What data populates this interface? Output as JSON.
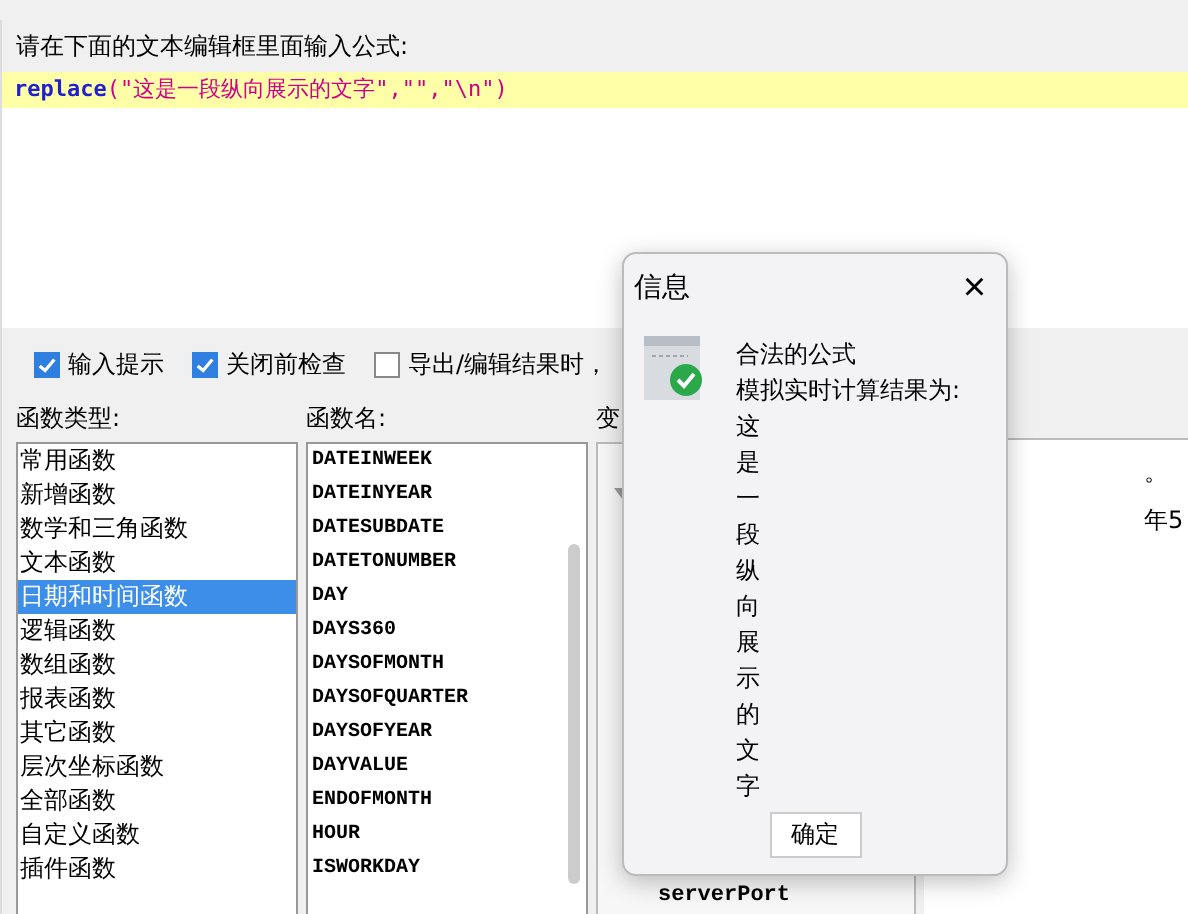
{
  "editor": {
    "label": "请在下面的文本编辑框里面输入公式:",
    "tokens": [
      {
        "kind": "fn",
        "text": "replace"
      },
      {
        "kind": "paren",
        "text": "("
      },
      {
        "kind": "string",
        "text": "\"这是一段纵向展示的文字\",\"\",\"\\n\""
      },
      {
        "kind": "paren",
        "text": ")"
      }
    ]
  },
  "options": [
    {
      "label": "输入提示",
      "checked": true
    },
    {
      "label": "关闭前检查",
      "checked": true
    },
    {
      "label": "导出/编辑结果时，",
      "checked": false
    }
  ],
  "categories": {
    "title": "函数类型:",
    "items": [
      {
        "label": "常用函数",
        "selected": false
      },
      {
        "label": "新增函数",
        "selected": false
      },
      {
        "label": "数学和三角函数",
        "selected": false
      },
      {
        "label": "文本函数",
        "selected": false
      },
      {
        "label": "日期和时间函数",
        "selected": true
      },
      {
        "label": "逻辑函数",
        "selected": false
      },
      {
        "label": "数组函数",
        "selected": false
      },
      {
        "label": "报表函数",
        "selected": false
      },
      {
        "label": "其它函数",
        "selected": false
      },
      {
        "label": "层次坐标函数",
        "selected": false
      },
      {
        "label": "全部函数",
        "selected": false
      },
      {
        "label": "自定义函数",
        "selected": false
      },
      {
        "label": "插件函数",
        "selected": false
      }
    ]
  },
  "functions": {
    "title": "函数名:",
    "items": [
      "DATEINWEEK",
      "DATEINYEAR",
      "DATESUBDATE",
      "DATETONUMBER",
      "DAY",
      "DAYS360",
      "DAYSOFMONTH",
      "DAYSOFQUARTER",
      "DAYSOFYEAR",
      "DAYVALUE",
      "ENDOFMONTH",
      "HOUR",
      "ISWORKDAY"
    ]
  },
  "variables": {
    "title": "变",
    "items": [
      "serverPort"
    ]
  },
  "description": {
    "lines": [
      "。",
      "年5"
    ]
  },
  "dialog": {
    "title": "信息",
    "close": "×",
    "lines": [
      "合法的公式",
      "模拟实时计算结果为:"
    ],
    "result": "这是一段纵向展示的文字",
    "button": "确定"
  }
}
